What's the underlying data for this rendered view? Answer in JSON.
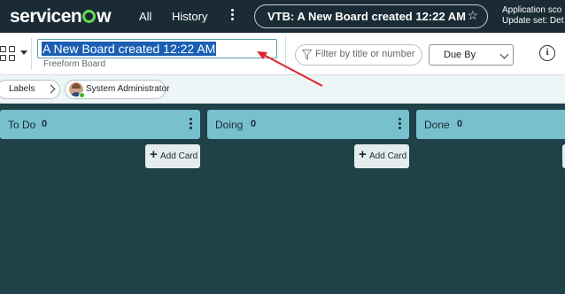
{
  "nav": {
    "brand": "servicenow",
    "brand_pre": "servicen",
    "brand_post": "w",
    "all_label": "All",
    "history_label": "History",
    "context_title": "VTB: A New Board created 12:22 AM",
    "app_scope_line1": "Application sco",
    "app_scope_line2": "Update set: Det"
  },
  "board": {
    "title_value": "A New Board created 12:22 AM",
    "subtitle": "Freeform Board",
    "filter_placeholder": "Filter by title or number",
    "sort_select": "Due By",
    "info_glyph": "i"
  },
  "filters": {
    "labels_chip": "Labels",
    "user_chip": "System Administrator"
  },
  "lanes": [
    {
      "title": "To Do",
      "count": "0",
      "add_label": "Add Card"
    },
    {
      "title": "Doing",
      "count": "0",
      "add_label": "Add Card"
    },
    {
      "title": "Done",
      "count": "0"
    }
  ],
  "colors": {
    "nav_bg": "#1a2b35",
    "board_bg": "#1e4248",
    "lane_header": "#79c0cf",
    "brand_accent": "#62d84e",
    "annotation": "#e0232b",
    "selection": "#1a5fb4"
  }
}
